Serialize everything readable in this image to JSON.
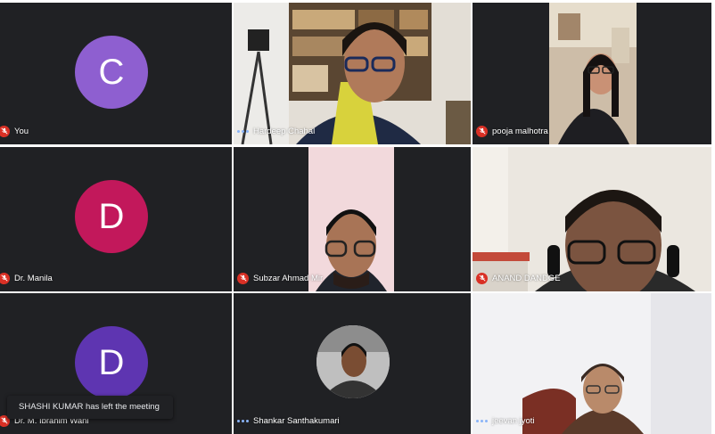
{
  "colors": {
    "tile_bg": "#202124",
    "muted_red": "#d93025",
    "speaking_blue": "#8ab4f8",
    "avatar_c": "#8e5fd0",
    "avatar_d_red": "#c2185b",
    "avatar_d_purple": "#5e35b1"
  },
  "participants": [
    {
      "name": "You",
      "avatar_letter": "C",
      "muted": true
    },
    {
      "name": "Hardeep Chahal",
      "muted": false
    },
    {
      "name": "pooja malhotra",
      "muted": true
    },
    {
      "name": "Dr. Manila",
      "avatar_letter": "D",
      "muted": true
    },
    {
      "name": "Subzar Ahmad Mir",
      "muted": true
    },
    {
      "name": "ANAND DANDGE",
      "muted": true
    },
    {
      "name": "Dr. M. Ibrahim Wani",
      "avatar_letter": "D",
      "muted": true
    },
    {
      "name": "Shankar Santhakumari",
      "muted": false
    },
    {
      "name": "jeevan jyoti",
      "muted": false
    }
  ],
  "notification": {
    "text": "SHASHI KUMAR has left the meeting"
  },
  "icons": {
    "muted": "mic-off-icon",
    "speaking": "audio-level-icon"
  }
}
